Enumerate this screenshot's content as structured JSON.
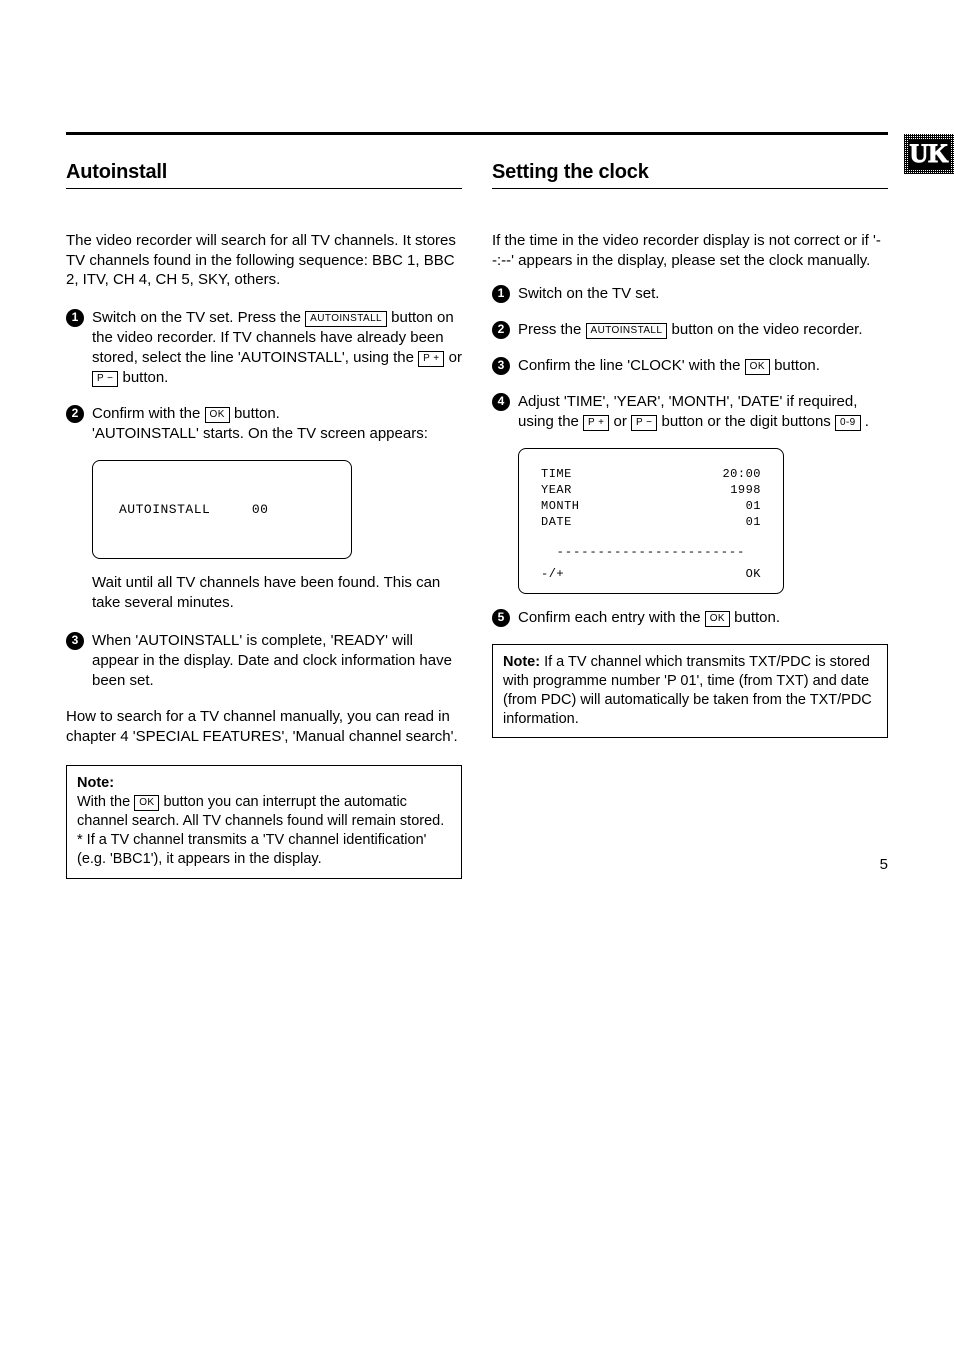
{
  "region": "UK",
  "page_number": "5",
  "left": {
    "heading": "Autoinstall",
    "intro": "The video recorder will search for all TV channels. It stores TV channels found in the following sequence: BBC 1, BBC 2, ITV, CH 4, CH 5, SKY, others.",
    "step1_a": "Switch on the TV set. Press the ",
    "step1_btn1": "AUTOINSTALL",
    "step1_b": " button on the video recorder. If TV channels have already been stored, select the line 'AUTOINSTALL', using the ",
    "step1_btn2": "P +",
    "step1_c": " or ",
    "step1_btn3": "P −",
    "step1_d": " button.",
    "step2_a": "Confirm with the ",
    "step2_btn": "OK",
    "step2_b": " button.",
    "step2_line2": "'AUTOINSTALL' starts. On the TV screen appears:",
    "screen_line": "AUTOINSTALL     00",
    "after_screen": "Wait until all TV channels have been found. This can take several minutes.",
    "step3": "When 'AUTOINSTALL' is complete, 'READY' will appear in the display. Date and clock information have been set.",
    "closing": "How to search for a TV channel manually, you can read in chapter 4 'SPECIAL FEATURES', 'Manual channel search'.",
    "note_label": "Note:",
    "note_a": "With the ",
    "note_btn": "OK",
    "note_b": " button you can interrupt the automatic channel search. All TV channels found will remain stored.",
    "note_c": "* If a TV channel transmits a 'TV channel identification' (e.g. 'BBC1'), it appears in the display."
  },
  "right": {
    "heading": "Setting the clock",
    "intro": "If the time in the video recorder display is not correct or if '--:--' appears in the display, please set the clock manually.",
    "step1": "Switch on the TV set.",
    "step2_a": "Press the ",
    "step2_btn": "AUTOINSTALL",
    "step2_b": " button on the video recorder.",
    "step3_a": "Confirm the line 'CLOCK' with the ",
    "step3_btn": "OK",
    "step3_b": " button.",
    "step4_a": "Adjust 'TIME', 'YEAR', 'MONTH', 'DATE' if required, using the ",
    "step4_btn1": "P +",
    "step4_b": " or ",
    "step4_btn2": "P −",
    "step4_c": " button or the digit buttons ",
    "step4_btn3": "0-9",
    "step4_d": " .",
    "screen": {
      "r1l": "TIME",
      "r1r": "20:00",
      "r2l": "YEAR",
      "r2r": "1998",
      "r3l": "MONTH",
      "r3r": "01",
      "r4l": "DATE",
      "r4r": "01",
      "dash": "-----------------------",
      "fl": "-/+",
      "fr": "OK"
    },
    "step5_a": "Confirm each entry with the ",
    "step5_btn": "OK",
    "step5_b": " button.",
    "note_label": "Note:",
    "note_rest": " If a TV channel which transmits TXT/PDC is stored with programme number 'P 01', time (from TXT) and date (from PDC) will automatically be taken from the TXT/PDC information."
  }
}
